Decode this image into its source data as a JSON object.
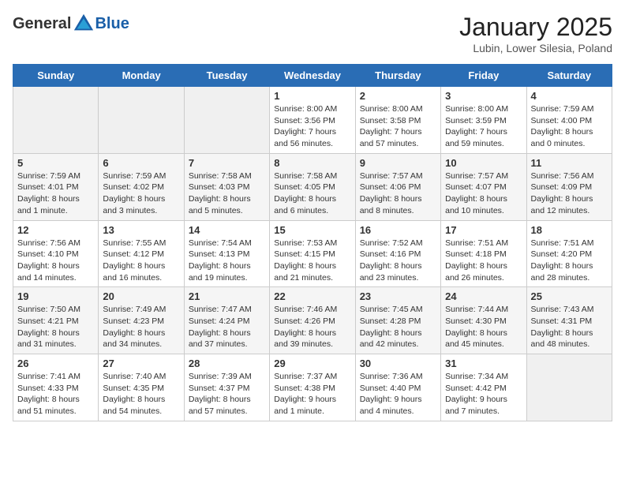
{
  "header": {
    "logo_general": "General",
    "logo_blue": "Blue",
    "month_title": "January 2025",
    "location": "Lubin, Lower Silesia, Poland"
  },
  "days_of_week": [
    "Sunday",
    "Monday",
    "Tuesday",
    "Wednesday",
    "Thursday",
    "Friday",
    "Saturday"
  ],
  "weeks": [
    [
      {
        "day": null,
        "info": null
      },
      {
        "day": null,
        "info": null
      },
      {
        "day": null,
        "info": null
      },
      {
        "day": "1",
        "info": "Sunrise: 8:00 AM\nSunset: 3:56 PM\nDaylight: 7 hours\nand 56 minutes."
      },
      {
        "day": "2",
        "info": "Sunrise: 8:00 AM\nSunset: 3:58 PM\nDaylight: 7 hours\nand 57 minutes."
      },
      {
        "day": "3",
        "info": "Sunrise: 8:00 AM\nSunset: 3:59 PM\nDaylight: 7 hours\nand 59 minutes."
      },
      {
        "day": "4",
        "info": "Sunrise: 7:59 AM\nSunset: 4:00 PM\nDaylight: 8 hours\nand 0 minutes."
      }
    ],
    [
      {
        "day": "5",
        "info": "Sunrise: 7:59 AM\nSunset: 4:01 PM\nDaylight: 8 hours\nand 1 minute."
      },
      {
        "day": "6",
        "info": "Sunrise: 7:59 AM\nSunset: 4:02 PM\nDaylight: 8 hours\nand 3 minutes."
      },
      {
        "day": "7",
        "info": "Sunrise: 7:58 AM\nSunset: 4:03 PM\nDaylight: 8 hours\nand 5 minutes."
      },
      {
        "day": "8",
        "info": "Sunrise: 7:58 AM\nSunset: 4:05 PM\nDaylight: 8 hours\nand 6 minutes."
      },
      {
        "day": "9",
        "info": "Sunrise: 7:57 AM\nSunset: 4:06 PM\nDaylight: 8 hours\nand 8 minutes."
      },
      {
        "day": "10",
        "info": "Sunrise: 7:57 AM\nSunset: 4:07 PM\nDaylight: 8 hours\nand 10 minutes."
      },
      {
        "day": "11",
        "info": "Sunrise: 7:56 AM\nSunset: 4:09 PM\nDaylight: 8 hours\nand 12 minutes."
      }
    ],
    [
      {
        "day": "12",
        "info": "Sunrise: 7:56 AM\nSunset: 4:10 PM\nDaylight: 8 hours\nand 14 minutes."
      },
      {
        "day": "13",
        "info": "Sunrise: 7:55 AM\nSunset: 4:12 PM\nDaylight: 8 hours\nand 16 minutes."
      },
      {
        "day": "14",
        "info": "Sunrise: 7:54 AM\nSunset: 4:13 PM\nDaylight: 8 hours\nand 19 minutes."
      },
      {
        "day": "15",
        "info": "Sunrise: 7:53 AM\nSunset: 4:15 PM\nDaylight: 8 hours\nand 21 minutes."
      },
      {
        "day": "16",
        "info": "Sunrise: 7:52 AM\nSunset: 4:16 PM\nDaylight: 8 hours\nand 23 minutes."
      },
      {
        "day": "17",
        "info": "Sunrise: 7:51 AM\nSunset: 4:18 PM\nDaylight: 8 hours\nand 26 minutes."
      },
      {
        "day": "18",
        "info": "Sunrise: 7:51 AM\nSunset: 4:20 PM\nDaylight: 8 hours\nand 28 minutes."
      }
    ],
    [
      {
        "day": "19",
        "info": "Sunrise: 7:50 AM\nSunset: 4:21 PM\nDaylight: 8 hours\nand 31 minutes."
      },
      {
        "day": "20",
        "info": "Sunrise: 7:49 AM\nSunset: 4:23 PM\nDaylight: 8 hours\nand 34 minutes."
      },
      {
        "day": "21",
        "info": "Sunrise: 7:47 AM\nSunset: 4:24 PM\nDaylight: 8 hours\nand 37 minutes."
      },
      {
        "day": "22",
        "info": "Sunrise: 7:46 AM\nSunset: 4:26 PM\nDaylight: 8 hours\nand 39 minutes."
      },
      {
        "day": "23",
        "info": "Sunrise: 7:45 AM\nSunset: 4:28 PM\nDaylight: 8 hours\nand 42 minutes."
      },
      {
        "day": "24",
        "info": "Sunrise: 7:44 AM\nSunset: 4:30 PM\nDaylight: 8 hours\nand 45 minutes."
      },
      {
        "day": "25",
        "info": "Sunrise: 7:43 AM\nSunset: 4:31 PM\nDaylight: 8 hours\nand 48 minutes."
      }
    ],
    [
      {
        "day": "26",
        "info": "Sunrise: 7:41 AM\nSunset: 4:33 PM\nDaylight: 8 hours\nand 51 minutes."
      },
      {
        "day": "27",
        "info": "Sunrise: 7:40 AM\nSunset: 4:35 PM\nDaylight: 8 hours\nand 54 minutes."
      },
      {
        "day": "28",
        "info": "Sunrise: 7:39 AM\nSunset: 4:37 PM\nDaylight: 8 hours\nand 57 minutes."
      },
      {
        "day": "29",
        "info": "Sunrise: 7:37 AM\nSunset: 4:38 PM\nDaylight: 9 hours\nand 1 minute."
      },
      {
        "day": "30",
        "info": "Sunrise: 7:36 AM\nSunset: 4:40 PM\nDaylight: 9 hours\nand 4 minutes."
      },
      {
        "day": "31",
        "info": "Sunrise: 7:34 AM\nSunset: 4:42 PM\nDaylight: 9 hours\nand 7 minutes."
      },
      {
        "day": null,
        "info": null
      }
    ]
  ]
}
